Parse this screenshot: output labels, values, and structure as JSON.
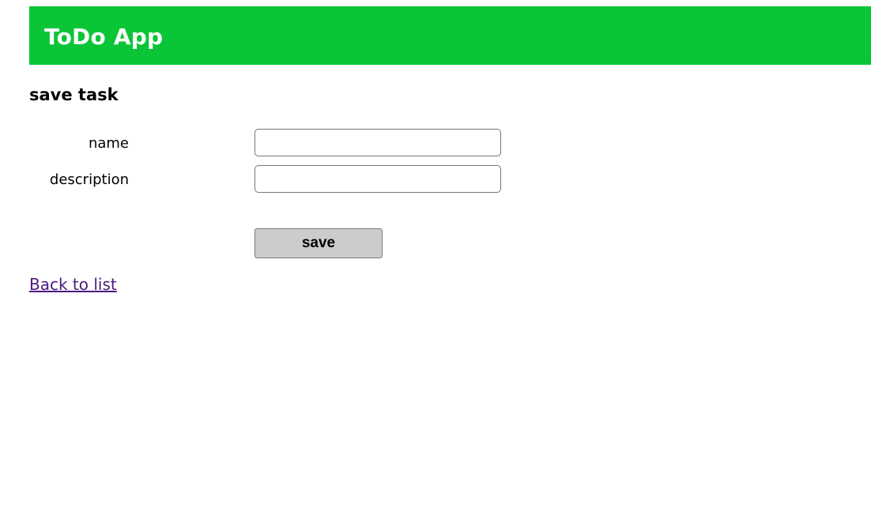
{
  "header": {
    "title": "ToDo App",
    "background_color": "#0ac536",
    "text_color": "#ffffff"
  },
  "page": {
    "heading": "save task"
  },
  "form": {
    "fields": [
      {
        "label": "name",
        "value": "",
        "placeholder": ""
      },
      {
        "label": "description",
        "value": "",
        "placeholder": ""
      }
    ],
    "save_label": "save",
    "save_button_color": "#cccccc"
  },
  "links": {
    "back_label": "Back to list",
    "link_color": "#4b1a7e"
  }
}
